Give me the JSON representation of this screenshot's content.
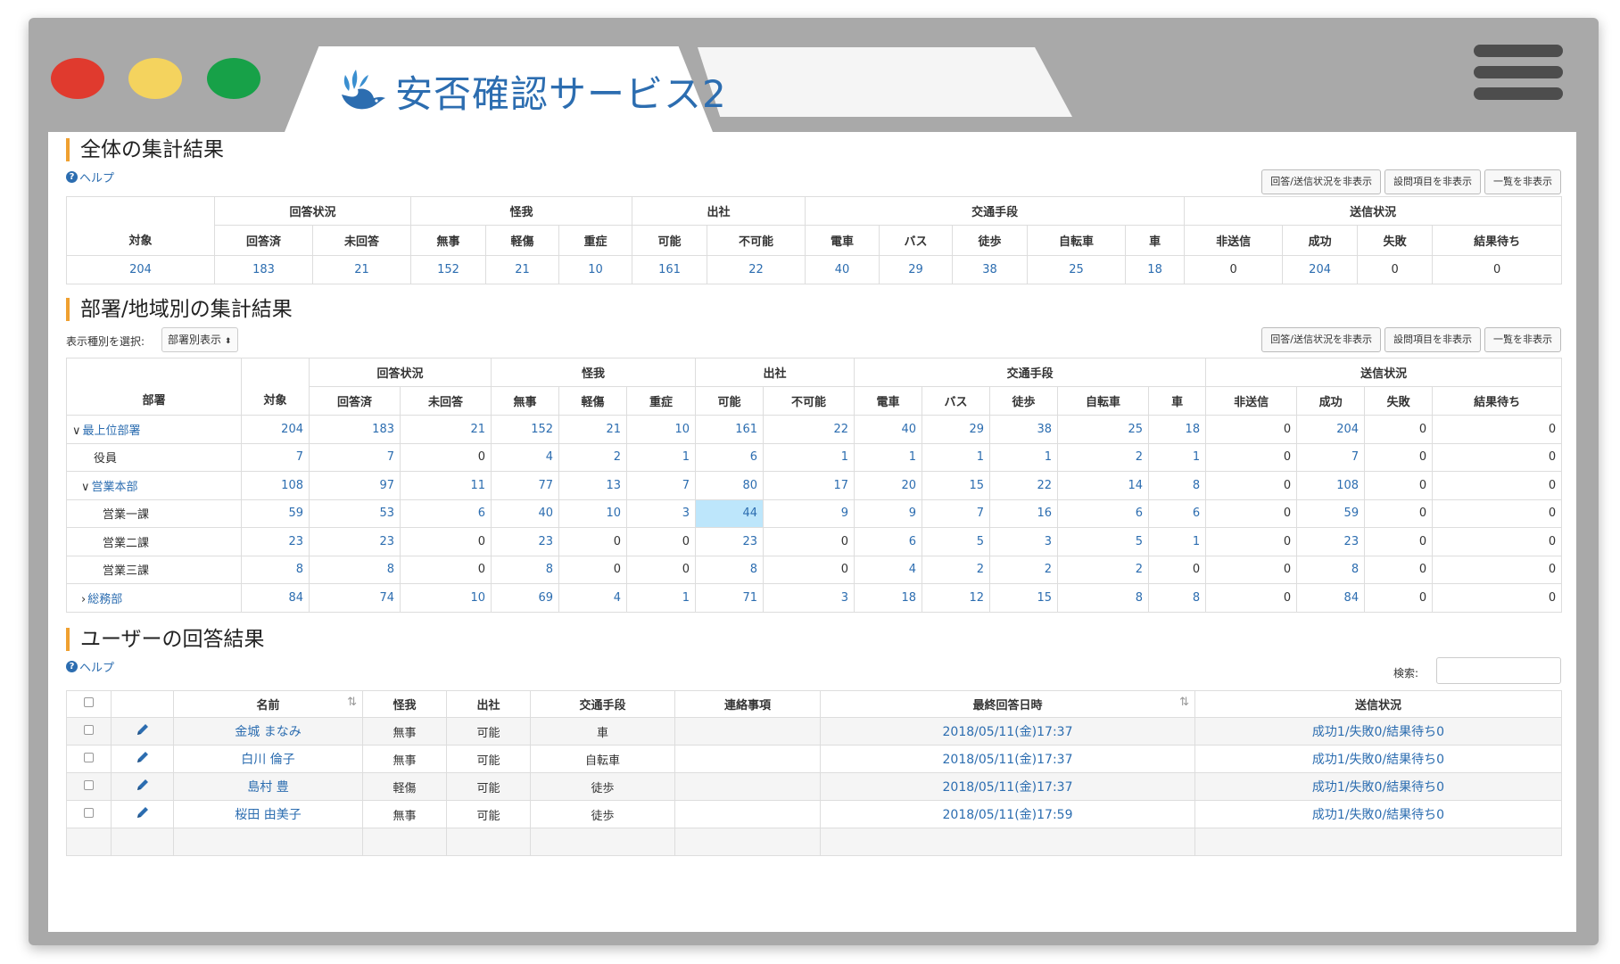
{
  "app": {
    "title": "安否確認サービス2"
  },
  "section1": {
    "title": "全体の集計結果",
    "help": "ヘルプ",
    "buttons": [
      "回答/送信状況を非表示",
      "設問項目を非表示",
      "一覧を非表示"
    ],
    "groups": [
      "回答状況",
      "怪我",
      "出社",
      "交通手段",
      "送信状況"
    ],
    "target_header": "対象",
    "headers": [
      "回答済",
      "未回答",
      "無事",
      "軽傷",
      "重症",
      "可能",
      "不可能",
      "電車",
      "バス",
      "徒歩",
      "自転車",
      "車",
      "非送信",
      "成功",
      "失敗",
      "結果待ち"
    ],
    "row": [
      "204",
      "183",
      "21",
      "152",
      "21",
      "10",
      "161",
      "22",
      "40",
      "29",
      "38",
      "25",
      "18",
      "0",
      "204",
      "0",
      "0"
    ]
  },
  "section2": {
    "title": "部署/地域別の集計結果",
    "select_label": "表示種別を選択:",
    "select_value": "部署別表示",
    "buttons": [
      "回答/送信状況を非表示",
      "設問項目を非表示",
      "一覧を非表示"
    ],
    "dept_header": "部署",
    "target_header": "対象",
    "groups": [
      "回答状況",
      "怪我",
      "出社",
      "交通手段",
      "送信状況"
    ],
    "headers": [
      "回答済",
      "未回答",
      "無事",
      "軽傷",
      "重症",
      "可能",
      "不可能",
      "電車",
      "バス",
      "徒歩",
      "自転車",
      "車",
      "非送信",
      "成功",
      "失敗",
      "結果待ち"
    ],
    "rows": [
      {
        "name": "最上位部署",
        "toggle": "∨",
        "link": true,
        "values": [
          "204",
          "183",
          "21",
          "152",
          "21",
          "10",
          "161",
          "22",
          "40",
          "29",
          "38",
          "25",
          "18",
          "0",
          "204",
          "0",
          "0"
        ]
      },
      {
        "name": "役員",
        "toggle": "",
        "link": false,
        "values": [
          "7",
          "7",
          "0",
          "4",
          "2",
          "1",
          "6",
          "1",
          "1",
          "1",
          "1",
          "2",
          "1",
          "0",
          "7",
          "0",
          "0"
        ]
      },
      {
        "name": "営業本部",
        "toggle": "∨",
        "link": true,
        "values": [
          "108",
          "97",
          "11",
          "77",
          "13",
          "7",
          "80",
          "17",
          "20",
          "15",
          "22",
          "14",
          "8",
          "0",
          "108",
          "0",
          "0"
        ]
      },
      {
        "name": "営業一課",
        "toggle": "",
        "link": false,
        "values": [
          "59",
          "53",
          "6",
          "40",
          "10",
          "3",
          "44",
          "9",
          "9",
          "7",
          "16",
          "6",
          "6",
          "0",
          "59",
          "0",
          "0"
        ]
      },
      {
        "name": "営業二課",
        "toggle": "",
        "link": false,
        "values": [
          "23",
          "23",
          "0",
          "23",
          "0",
          "0",
          "23",
          "0",
          "6",
          "5",
          "3",
          "5",
          "1",
          "0",
          "23",
          "0",
          "0"
        ]
      },
      {
        "name": "営業三課",
        "toggle": "",
        "link": false,
        "values": [
          "8",
          "8",
          "0",
          "8",
          "0",
          "0",
          "8",
          "0",
          "4",
          "2",
          "2",
          "2",
          "0",
          "0",
          "8",
          "0",
          "0"
        ]
      },
      {
        "name": "総務部",
        "toggle": "›",
        "link": true,
        "values": [
          "84",
          "74",
          "10",
          "69",
          "4",
          "1",
          "71",
          "3",
          "18",
          "12",
          "15",
          "8",
          "8",
          "0",
          "84",
          "0",
          "0"
        ]
      }
    ]
  },
  "section3": {
    "title": "ユーザーの回答結果",
    "help": "ヘルプ",
    "search_label": "検索:",
    "headers": [
      "名前",
      "怪我",
      "出社",
      "交通手段",
      "連絡事項",
      "最終回答日時",
      "送信状況"
    ],
    "rows": [
      {
        "name": "金城 まなみ",
        "injury": "無事",
        "attend": "可能",
        "transport": "車",
        "note": "",
        "datetime": "2018/05/11(金)17:37",
        "status": "成功1/失敗0/結果待ち0"
      },
      {
        "name": "白川 倫子",
        "injury": "無事",
        "attend": "可能",
        "transport": "自転車",
        "note": "",
        "datetime": "2018/05/11(金)17:37",
        "status": "成功1/失敗0/結果待ち0"
      },
      {
        "name": "島村 豊",
        "injury": "軽傷",
        "attend": "可能",
        "transport": "徒歩",
        "note": "",
        "datetime": "2018/05/11(金)17:37",
        "status": "成功1/失敗0/結果待ち0"
      },
      {
        "name": "桜田 由美子",
        "injury": "無事",
        "attend": "可能",
        "transport": "徒歩",
        "note": "",
        "datetime": "2018/05/11(金)17:59",
        "status": "成功1/失敗0/結果待ち0"
      }
    ]
  },
  "colors": {
    "link": "#2c6db0",
    "accent": "#f0a030",
    "highlight": "#bde6fb"
  }
}
